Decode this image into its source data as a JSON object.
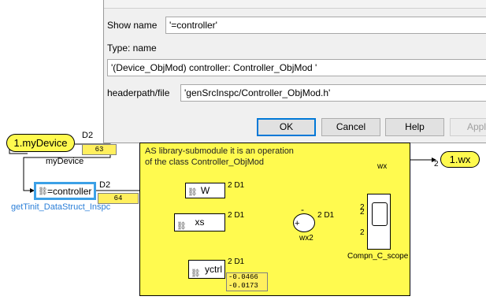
{
  "dialog": {
    "show_name_label": "Show name",
    "show_name_value": "'=controller'",
    "type_label": "Type: name",
    "type_value": "'(Device_ObjMod) controller: Controller_ObjMod '",
    "headerpath_label": "headerpath/file",
    "headerpath_value": "'genSrcInspc/Controller_ObjMod.h'",
    "buttons": {
      "ok": "OK",
      "cancel": "Cancel",
      "help": "Help",
      "apply": "Apply"
    }
  },
  "model": {
    "from_tag": "1.myDevice",
    "from_port": "D2",
    "display_63": "63",
    "signal_mydevice": "myDevice",
    "controller_block": "=controller",
    "controller_port": "D2",
    "display_64": "64",
    "controller_caption": "getTinit_DataStruct_Inspc",
    "subsystem_note_line1": "AS library-submodule it is an operation",
    "subsystem_note_line2": "of the class Controller_ObjMod",
    "block_w": "W",
    "block_xs": "xs",
    "block_yctrl": "yctrl",
    "port_w": "2 D1",
    "port_xs": "2 D1",
    "port_sum": "2 D1",
    "port_yctrl": "2 D1",
    "sum_minus": "-",
    "sum_plus": "+",
    "sum_caption": "wx2",
    "wire_wx": "wx",
    "goto_port": "2",
    "goto_tag": "1.wx",
    "scope_ports": [
      "2",
      "2",
      "2"
    ],
    "scope_caption": "Compn_C_scope",
    "display_yctrl_1": "-0.0466",
    "display_yctrl_2": "-0.0173"
  },
  "colors": {
    "block_yellow": "#fffa4f",
    "display_yellow": "#ffef5e",
    "selection_blue": "#3ca0e6",
    "caption_blue": "#2b7fd8"
  },
  "icons": [
    "link-icon",
    "scope-screen-icon"
  ]
}
